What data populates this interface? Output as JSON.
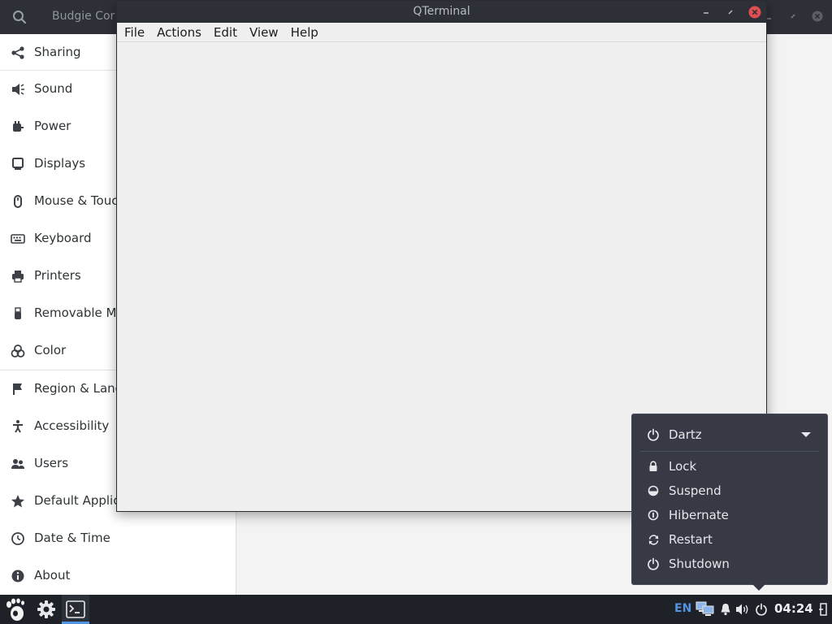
{
  "settings": {
    "title": "Budgie Cor",
    "sidebar": [
      {
        "label": "Sharing",
        "icon": "share-icon"
      },
      {
        "label": "Sound",
        "icon": "speaker-icon"
      },
      {
        "label": "Power",
        "icon": "power-plug-icon"
      },
      {
        "label": "Displays",
        "icon": "display-icon"
      },
      {
        "label": "Mouse & Touc",
        "icon": "mouse-icon"
      },
      {
        "label": "Keyboard",
        "icon": "keyboard-icon"
      },
      {
        "label": "Printers",
        "icon": "printer-icon"
      },
      {
        "label": "Removable M",
        "icon": "usb-icon"
      },
      {
        "label": "Color",
        "icon": "color-icon"
      },
      {
        "label": "Region & Lang",
        "icon": "flag-icon"
      },
      {
        "label": "Accessibility",
        "icon": "accessibility-icon"
      },
      {
        "label": "Users",
        "icon": "users-icon"
      },
      {
        "label": "Default Applic",
        "icon": "star-icon"
      },
      {
        "label": "Date & Time",
        "icon": "clock-icon"
      },
      {
        "label": "About",
        "icon": "info-icon"
      }
    ]
  },
  "qterminal": {
    "title": "QTerminal",
    "menu": [
      "File",
      "Actions",
      "Edit",
      "View",
      "Help"
    ]
  },
  "power_menu": {
    "user": "Dartz",
    "items": [
      {
        "label": "Lock",
        "icon": "lock-icon"
      },
      {
        "label": "Suspend",
        "icon": "suspend-icon"
      },
      {
        "label": "Hibernate",
        "icon": "hibernate-icon"
      },
      {
        "label": "Restart",
        "icon": "restart-icon"
      },
      {
        "label": "Shutdown",
        "icon": "shutdown-icon"
      }
    ]
  },
  "panel": {
    "language": "EN",
    "clock": "04:24",
    "accent": "#5294e2"
  },
  "colors": {
    "panel_bg": "#1f2128",
    "titlebar_bg": "#2e3038",
    "close_button": "#e04f4f",
    "popover_bg": "#373a45"
  }
}
